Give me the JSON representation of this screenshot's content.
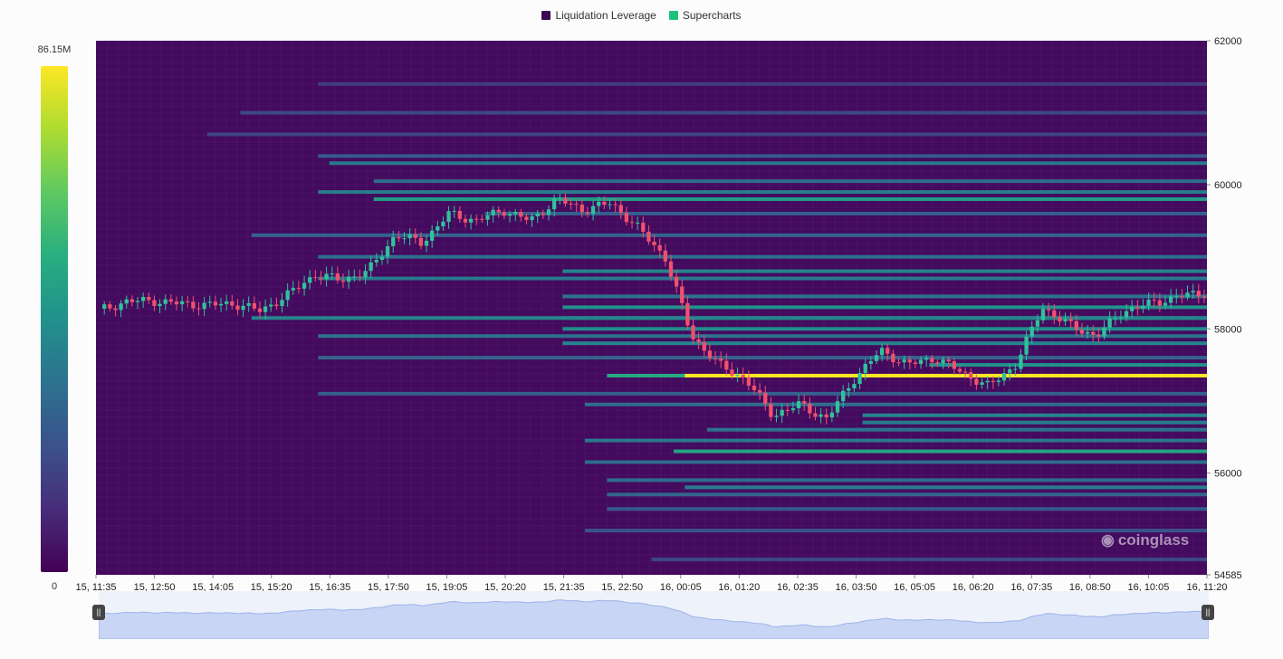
{
  "legend": [
    {
      "label": "Liquidation Leverage",
      "color": "#3b0a55"
    },
    {
      "label": "Supercharts",
      "color": "#19c37d"
    }
  ],
  "colorbar": {
    "max_label": "86.15M",
    "min_label": "0"
  },
  "watermark": "coinglass",
  "chart_data": {
    "type": "heatmap",
    "y_ticks": [
      "62000",
      "60000",
      "58000",
      "56000",
      "54585"
    ],
    "ylim": [
      54585,
      62000
    ],
    "x_ticks": [
      "15, 11:35",
      "15, 12:50",
      "15, 14:05",
      "15, 15:20",
      "15, 16:35",
      "15, 17:50",
      "15, 19:05",
      "15, 20:20",
      "15, 21:35",
      "15, 22:50",
      "16, 00:05",
      "16, 01:20",
      "16, 02:35",
      "16, 03:50",
      "16, 05:05",
      "16, 06:20",
      "16, 07:35",
      "16, 08:50",
      "16, 10:05",
      "16, 11:20"
    ],
    "colorscale_max": 86150000,
    "liquidation_bands": [
      {
        "price": 61400,
        "start": 0.2,
        "intensity": 0.18
      },
      {
        "price": 61000,
        "start": 0.13,
        "intensity": 0.22
      },
      {
        "price": 60700,
        "start": 0.1,
        "intensity": 0.2
      },
      {
        "price": 60400,
        "start": 0.2,
        "intensity": 0.28
      },
      {
        "price": 60300,
        "start": 0.21,
        "intensity": 0.4
      },
      {
        "price": 60050,
        "start": 0.25,
        "intensity": 0.35
      },
      {
        "price": 59900,
        "start": 0.2,
        "intensity": 0.42
      },
      {
        "price": 59800,
        "start": 0.25,
        "intensity": 0.55
      },
      {
        "price": 59600,
        "start": 0.35,
        "intensity": 0.3
      },
      {
        "price": 59300,
        "start": 0.14,
        "intensity": 0.32
      },
      {
        "price": 59000,
        "start": 0.2,
        "intensity": 0.36
      },
      {
        "price": 58800,
        "start": 0.42,
        "intensity": 0.45
      },
      {
        "price": 58700,
        "start": 0.2,
        "intensity": 0.4
      },
      {
        "price": 58450,
        "start": 0.42,
        "intensity": 0.38
      },
      {
        "price": 58300,
        "start": 0.42,
        "intensity": 0.5
      },
      {
        "price": 58150,
        "start": 0.42,
        "intensity": 0.62
      },
      {
        "price": 58150,
        "start": 0.14,
        "intensity": 0.45
      },
      {
        "price": 58000,
        "start": 0.42,
        "intensity": 0.48
      },
      {
        "price": 57900,
        "start": 0.2,
        "intensity": 0.38
      },
      {
        "price": 57800,
        "start": 0.42,
        "intensity": 0.45
      },
      {
        "price": 57600,
        "start": 0.2,
        "intensity": 0.32
      },
      {
        "price": 57500,
        "start": 0.75,
        "intensity": 0.5
      },
      {
        "price": 57350,
        "start": 0.46,
        "intensity": 0.6
      },
      {
        "price": 57350,
        "start": 0.53,
        "intensity": 1.0
      },
      {
        "price": 57100,
        "start": 0.2,
        "intensity": 0.3
      },
      {
        "price": 56950,
        "start": 0.44,
        "intensity": 0.35
      },
      {
        "price": 56800,
        "start": 0.69,
        "intensity": 0.45
      },
      {
        "price": 56700,
        "start": 0.69,
        "intensity": 0.42
      },
      {
        "price": 56600,
        "start": 0.55,
        "intensity": 0.38
      },
      {
        "price": 56450,
        "start": 0.44,
        "intensity": 0.4
      },
      {
        "price": 56300,
        "start": 0.52,
        "intensity": 0.58
      },
      {
        "price": 56150,
        "start": 0.44,
        "intensity": 0.35
      },
      {
        "price": 55900,
        "start": 0.46,
        "intensity": 0.35
      },
      {
        "price": 55800,
        "start": 0.53,
        "intensity": 0.42
      },
      {
        "price": 55700,
        "start": 0.46,
        "intensity": 0.32
      },
      {
        "price": 55500,
        "start": 0.46,
        "intensity": 0.28
      },
      {
        "price": 55200,
        "start": 0.44,
        "intensity": 0.25
      },
      {
        "price": 54800,
        "start": 0.5,
        "intensity": 0.22
      }
    ],
    "price_path": [
      58250,
      58380,
      58390,
      58350,
      58330,
      58350,
      58250,
      58470,
      58750,
      58680,
      58800,
      59300,
      59200,
      59600,
      59500,
      59650,
      59500,
      59800,
      59650,
      59750,
      59400,
      59000,
      57900,
      57500,
      57300,
      56800,
      56950,
      56750,
      57300,
      57700,
      57500,
      57600,
      57400,
      57200,
      57500,
      58300,
      58050,
      57900,
      58250,
      58350,
      58450,
      58500
    ]
  }
}
